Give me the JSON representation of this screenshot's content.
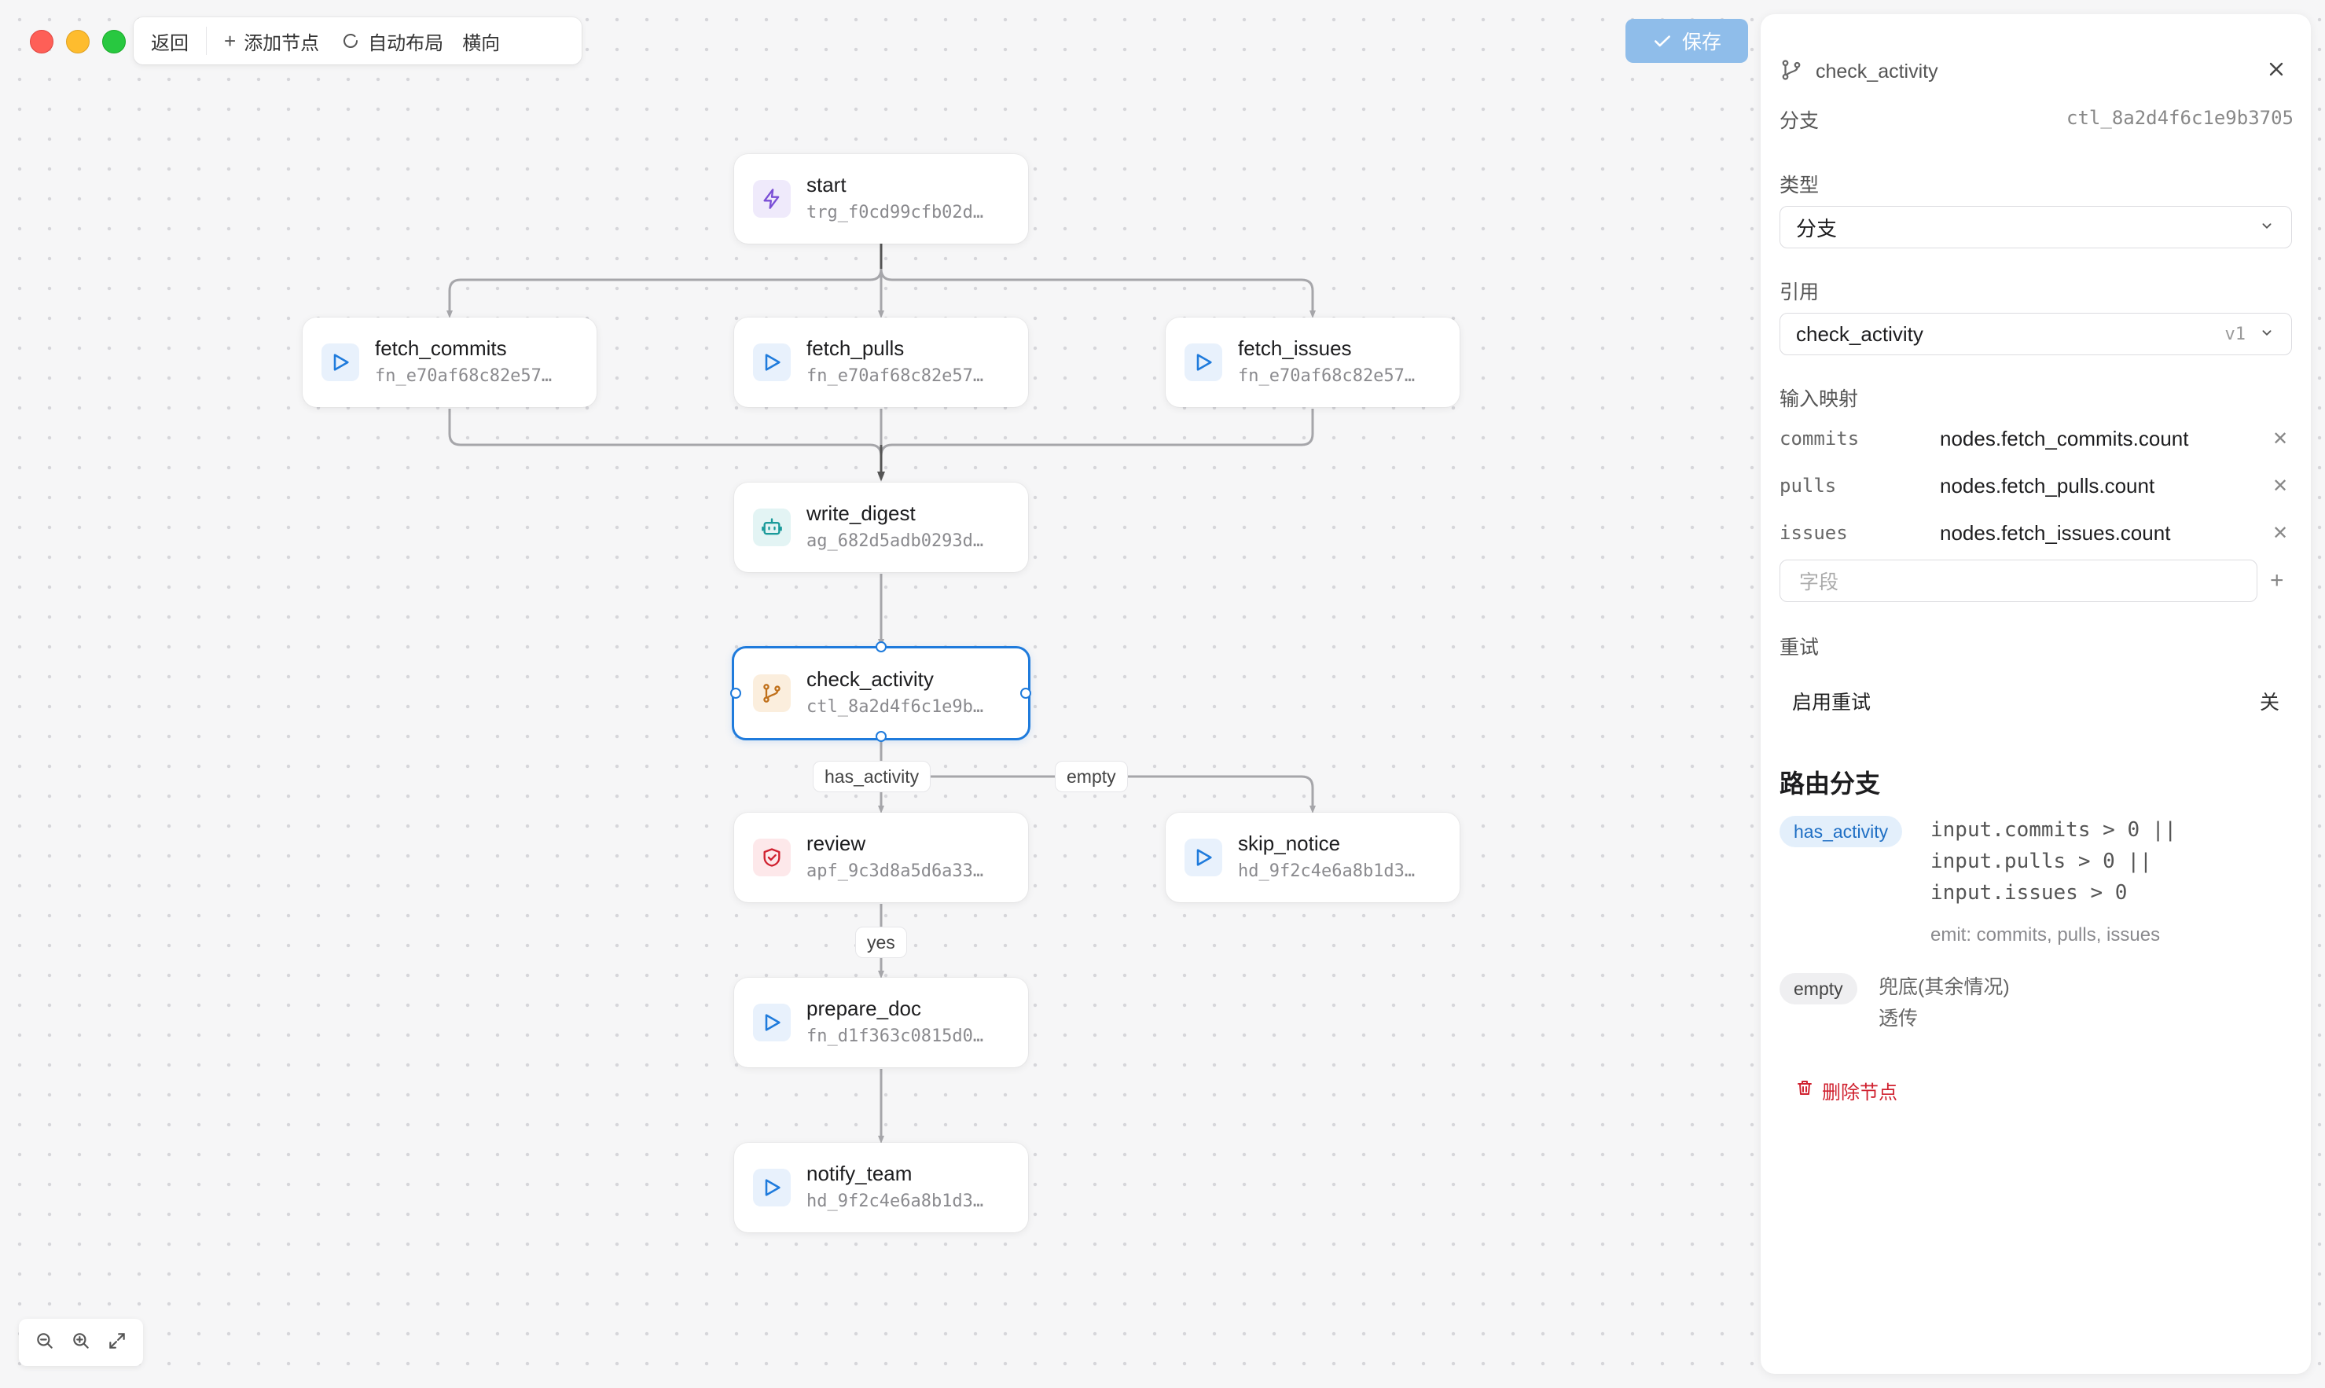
{
  "toolbar": {
    "back_label": "返回",
    "add_node_label": "添加节点",
    "auto_layout_label": "自动布局",
    "orientation_label": "横向"
  },
  "save_label": "保存",
  "nodes": {
    "start": {
      "title": "start",
      "sub": "trg_f0cd99cfb02d…"
    },
    "fetch_commits": {
      "title": "fetch_commits",
      "sub": "fn_e70af68c82e57…"
    },
    "fetch_pulls": {
      "title": "fetch_pulls",
      "sub": "fn_e70af68c82e57…"
    },
    "fetch_issues": {
      "title": "fetch_issues",
      "sub": "fn_e70af68c82e57…"
    },
    "write_digest": {
      "title": "write_digest",
      "sub": "ag_682d5adb0293d…"
    },
    "check_activity": {
      "title": "check_activity",
      "sub": "ctl_8a2d4f6c1e9b…"
    },
    "review": {
      "title": "review",
      "sub": "apf_9c3d8a5d6a33…"
    },
    "skip_notice": {
      "title": "skip_notice",
      "sub": "hd_9f2c4e6a8b1d3…"
    },
    "prepare_doc": {
      "title": "prepare_doc",
      "sub": "fn_d1f363c0815d0…"
    },
    "notify_team": {
      "title": "notify_team",
      "sub": "hd_9f2c4e6a8b1d3…"
    }
  },
  "edge_labels": {
    "has_activity": "has_activity",
    "empty": "empty",
    "yes": "yes"
  },
  "panel": {
    "node_name": "check_activity",
    "kind": "分支",
    "node_id": "ctl_8a2d4f6c1e9b3705",
    "type_label": "类型",
    "type_value": "分支",
    "ref_label": "引用",
    "ref_value": "check_activity",
    "ref_version": "v1",
    "input_map_label": "输入映射",
    "mappings": [
      {
        "key": "commits",
        "value": "nodes.fetch_commits.count"
      },
      {
        "key": "pulls",
        "value": "nodes.fetch_pulls.count"
      },
      {
        "key": "issues",
        "value": "nodes.fetch_issues.count"
      }
    ],
    "field_placeholder": "字段",
    "retry_label": "重试",
    "retry_enable_label": "启用重试",
    "retry_state": "关",
    "routes_title": "路由分支",
    "routes": [
      {
        "name": "has_activity",
        "lines": [
          "input.commits > 0 ||",
          "input.pulls > 0 ||",
          "input.issues > 0"
        ],
        "emit": "emit: commits, pulls, issues"
      },
      {
        "name": "empty",
        "lines": [
          "兜底(其余情况)",
          "透传"
        ]
      }
    ],
    "delete_label": "删除节点"
  },
  "colors": {
    "accent": "#1f7bdc",
    "save_bg": "#8fbdea",
    "danger": "#d0212f",
    "route_pill_bg": "#e3effb",
    "edge": "#a6a6aa"
  }
}
